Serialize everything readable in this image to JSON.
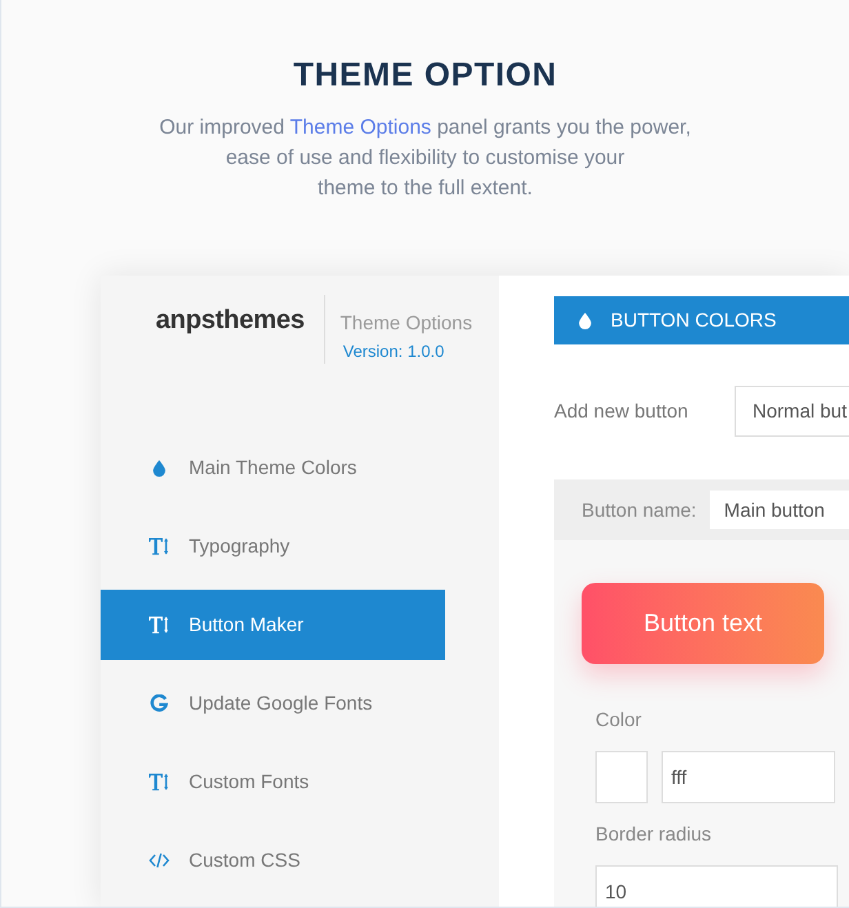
{
  "header": {
    "title": "THEME OPTION",
    "intro": {
      "before": "Our improved ",
      "link": "Theme Options",
      "after": " panel grants you the power,\nease of use and flexibility to customise your\ntheme to the full extent."
    }
  },
  "sidebar": {
    "logo": "anpsthemes",
    "product": "Theme Options",
    "version": "Version: 1.0.0",
    "items": [
      {
        "label": "Main Theme Colors",
        "kind": "drop",
        "selected": false
      },
      {
        "label": "Typography",
        "kind": "type",
        "selected": false
      },
      {
        "label": "Button Maker",
        "kind": "type",
        "selected": true
      },
      {
        "label": "Update Google Fonts",
        "kind": "google",
        "selected": false
      },
      {
        "label": "Custom Fonts",
        "kind": "type",
        "selected": false
      },
      {
        "label": "Custom CSS",
        "kind": "code",
        "selected": false
      }
    ]
  },
  "main": {
    "section_title": "BUTTON COLORS",
    "add_button": {
      "label": "Add new button",
      "value": "Normal but"
    },
    "button_name": {
      "label": "Button name:",
      "value": "Main button"
    },
    "preview_button": "Button text",
    "color": {
      "label": "Color",
      "value": "fff"
    },
    "border_radius": {
      "label": "Border radius",
      "value": "10"
    }
  }
}
